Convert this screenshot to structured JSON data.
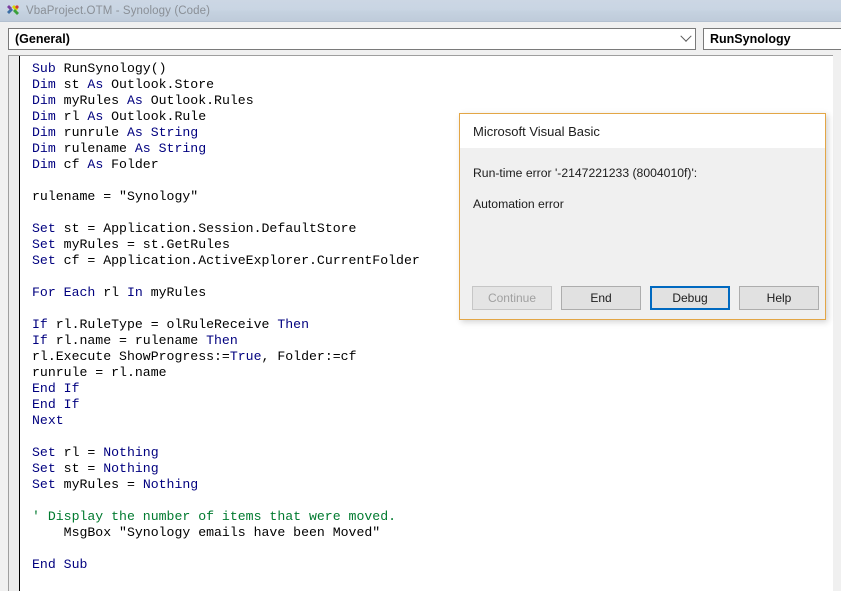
{
  "window": {
    "title": "VbaProject.OTM - Synology (Code)",
    "icon": "vba-project-icon"
  },
  "toolbar": {
    "object_combo": {
      "value": "(General)",
      "arrow_icon": "chevron-down-icon"
    },
    "procedure_combo": {
      "value": "RunSynology",
      "arrow_icon": "chevron-down-icon"
    }
  },
  "code": {
    "lines": [
      [
        {
          "t": "Sub",
          "c": "kw"
        },
        {
          "t": " RunSynology()",
          "c": "pln"
        }
      ],
      [
        {
          "t": "Dim",
          "c": "kw"
        },
        {
          "t": " st ",
          "c": "pln"
        },
        {
          "t": "As",
          "c": "kw"
        },
        {
          "t": " Outlook.Store",
          "c": "pln"
        }
      ],
      [
        {
          "t": "Dim",
          "c": "kw"
        },
        {
          "t": " myRules ",
          "c": "pln"
        },
        {
          "t": "As",
          "c": "kw"
        },
        {
          "t": " Outlook.Rules",
          "c": "pln"
        }
      ],
      [
        {
          "t": "Dim",
          "c": "kw"
        },
        {
          "t": " rl ",
          "c": "pln"
        },
        {
          "t": "As",
          "c": "kw"
        },
        {
          "t": " Outlook.Rule",
          "c": "pln"
        }
      ],
      [
        {
          "t": "Dim",
          "c": "kw"
        },
        {
          "t": " runrule ",
          "c": "pln"
        },
        {
          "t": "As",
          "c": "kw"
        },
        {
          "t": " String",
          "c": "kw"
        }
      ],
      [
        {
          "t": "Dim",
          "c": "kw"
        },
        {
          "t": " rulename ",
          "c": "pln"
        },
        {
          "t": "As",
          "c": "kw"
        },
        {
          "t": " String",
          "c": "kw"
        }
      ],
      [
        {
          "t": "Dim",
          "c": "kw"
        },
        {
          "t": " cf ",
          "c": "pln"
        },
        {
          "t": "As",
          "c": "kw"
        },
        {
          "t": " Folder",
          "c": "pln"
        }
      ],
      [],
      [
        {
          "t": "rulename = \"Synology\"",
          "c": "pln"
        }
      ],
      [],
      [
        {
          "t": "Set",
          "c": "kw"
        },
        {
          "t": " st = Application.Session.DefaultStore",
          "c": "pln"
        }
      ],
      [
        {
          "t": "Set",
          "c": "kw"
        },
        {
          "t": " myRules = st.GetRules",
          "c": "pln"
        }
      ],
      [
        {
          "t": "Set",
          "c": "kw"
        },
        {
          "t": " cf = Application.ActiveExplorer.CurrentFolder",
          "c": "pln"
        }
      ],
      [],
      [
        {
          "t": "For Each",
          "c": "kw"
        },
        {
          "t": " rl ",
          "c": "pln"
        },
        {
          "t": "In",
          "c": "kw"
        },
        {
          "t": " myRules",
          "c": "pln"
        }
      ],
      [],
      [
        {
          "t": "If",
          "c": "kw"
        },
        {
          "t": " rl.RuleType = olRuleReceive ",
          "c": "pln"
        },
        {
          "t": "Then",
          "c": "kw"
        }
      ],
      [
        {
          "t": "If",
          "c": "kw"
        },
        {
          "t": " rl.name = rulename ",
          "c": "pln"
        },
        {
          "t": "Then",
          "c": "kw"
        }
      ],
      [
        {
          "t": "rl.Execute ShowProgress:=",
          "c": "pln"
        },
        {
          "t": "True",
          "c": "kw"
        },
        {
          "t": ", Folder:=cf",
          "c": "pln"
        }
      ],
      [
        {
          "t": "runrule = rl.name",
          "c": "pln"
        }
      ],
      [
        {
          "t": "End If",
          "c": "kw"
        }
      ],
      [
        {
          "t": "End If",
          "c": "kw"
        }
      ],
      [
        {
          "t": "Next",
          "c": "kw"
        }
      ],
      [],
      [
        {
          "t": "Set",
          "c": "kw"
        },
        {
          "t": " rl = ",
          "c": "pln"
        },
        {
          "t": "Nothing",
          "c": "kw"
        }
      ],
      [
        {
          "t": "Set",
          "c": "kw"
        },
        {
          "t": " st = ",
          "c": "pln"
        },
        {
          "t": "Nothing",
          "c": "kw"
        }
      ],
      [
        {
          "t": "Set",
          "c": "kw"
        },
        {
          "t": " myRules = ",
          "c": "pln"
        },
        {
          "t": "Nothing",
          "c": "kw"
        }
      ],
      [],
      [
        {
          "t": "' Display the number of items that were moved.",
          "c": "cmt"
        }
      ],
      [
        {
          "t": "    MsgBox \"Synology emails have been Moved\"",
          "c": "pln"
        }
      ],
      [],
      [
        {
          "t": "End Sub",
          "c": "kw"
        }
      ]
    ],
    "colors": {
      "keyword": "#00007f",
      "comment": "#007a2f",
      "plain": "#000000"
    }
  },
  "dialog": {
    "title": "Microsoft Visual Basic",
    "message_line1": "Run-time error '-2147221233 (8004010f)':",
    "message_line2": "Automation error",
    "border_color": "#e3a646",
    "buttons": [
      {
        "label": "Continue",
        "state": "disabled"
      },
      {
        "label": "End",
        "state": "enabled"
      },
      {
        "label": "Debug",
        "state": "default"
      },
      {
        "label": "Help",
        "state": "enabled"
      }
    ]
  }
}
